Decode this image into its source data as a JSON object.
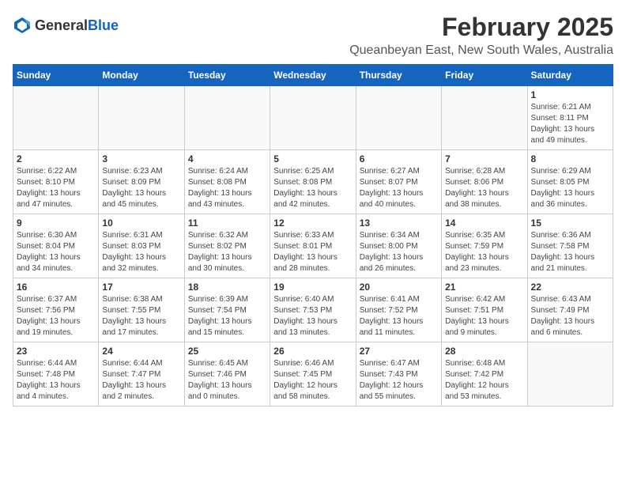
{
  "header": {
    "logo_general": "General",
    "logo_blue": "Blue",
    "month": "February 2025",
    "location": "Queanbeyan East, New South Wales, Australia"
  },
  "days_of_week": [
    "Sunday",
    "Monday",
    "Tuesday",
    "Wednesday",
    "Thursday",
    "Friday",
    "Saturday"
  ],
  "weeks": [
    [
      {
        "day": "",
        "info": ""
      },
      {
        "day": "",
        "info": ""
      },
      {
        "day": "",
        "info": ""
      },
      {
        "day": "",
        "info": ""
      },
      {
        "day": "",
        "info": ""
      },
      {
        "day": "",
        "info": ""
      },
      {
        "day": "1",
        "info": "Sunrise: 6:21 AM\nSunset: 8:11 PM\nDaylight: 13 hours\nand 49 minutes."
      }
    ],
    [
      {
        "day": "2",
        "info": "Sunrise: 6:22 AM\nSunset: 8:10 PM\nDaylight: 13 hours\nand 47 minutes."
      },
      {
        "day": "3",
        "info": "Sunrise: 6:23 AM\nSunset: 8:09 PM\nDaylight: 13 hours\nand 45 minutes."
      },
      {
        "day": "4",
        "info": "Sunrise: 6:24 AM\nSunset: 8:08 PM\nDaylight: 13 hours\nand 43 minutes."
      },
      {
        "day": "5",
        "info": "Sunrise: 6:25 AM\nSunset: 8:08 PM\nDaylight: 13 hours\nand 42 minutes."
      },
      {
        "day": "6",
        "info": "Sunrise: 6:27 AM\nSunset: 8:07 PM\nDaylight: 13 hours\nand 40 minutes."
      },
      {
        "day": "7",
        "info": "Sunrise: 6:28 AM\nSunset: 8:06 PM\nDaylight: 13 hours\nand 38 minutes."
      },
      {
        "day": "8",
        "info": "Sunrise: 6:29 AM\nSunset: 8:05 PM\nDaylight: 13 hours\nand 36 minutes."
      }
    ],
    [
      {
        "day": "9",
        "info": "Sunrise: 6:30 AM\nSunset: 8:04 PM\nDaylight: 13 hours\nand 34 minutes."
      },
      {
        "day": "10",
        "info": "Sunrise: 6:31 AM\nSunset: 8:03 PM\nDaylight: 13 hours\nand 32 minutes."
      },
      {
        "day": "11",
        "info": "Sunrise: 6:32 AM\nSunset: 8:02 PM\nDaylight: 13 hours\nand 30 minutes."
      },
      {
        "day": "12",
        "info": "Sunrise: 6:33 AM\nSunset: 8:01 PM\nDaylight: 13 hours\nand 28 minutes."
      },
      {
        "day": "13",
        "info": "Sunrise: 6:34 AM\nSunset: 8:00 PM\nDaylight: 13 hours\nand 26 minutes."
      },
      {
        "day": "14",
        "info": "Sunrise: 6:35 AM\nSunset: 7:59 PM\nDaylight: 13 hours\nand 23 minutes."
      },
      {
        "day": "15",
        "info": "Sunrise: 6:36 AM\nSunset: 7:58 PM\nDaylight: 13 hours\nand 21 minutes."
      }
    ],
    [
      {
        "day": "16",
        "info": "Sunrise: 6:37 AM\nSunset: 7:56 PM\nDaylight: 13 hours\nand 19 minutes."
      },
      {
        "day": "17",
        "info": "Sunrise: 6:38 AM\nSunset: 7:55 PM\nDaylight: 13 hours\nand 17 minutes."
      },
      {
        "day": "18",
        "info": "Sunrise: 6:39 AM\nSunset: 7:54 PM\nDaylight: 13 hours\nand 15 minutes."
      },
      {
        "day": "19",
        "info": "Sunrise: 6:40 AM\nSunset: 7:53 PM\nDaylight: 13 hours\nand 13 minutes."
      },
      {
        "day": "20",
        "info": "Sunrise: 6:41 AM\nSunset: 7:52 PM\nDaylight: 13 hours\nand 11 minutes."
      },
      {
        "day": "21",
        "info": "Sunrise: 6:42 AM\nSunset: 7:51 PM\nDaylight: 13 hours\nand 9 minutes."
      },
      {
        "day": "22",
        "info": "Sunrise: 6:43 AM\nSunset: 7:49 PM\nDaylight: 13 hours\nand 6 minutes."
      }
    ],
    [
      {
        "day": "23",
        "info": "Sunrise: 6:44 AM\nSunset: 7:48 PM\nDaylight: 13 hours\nand 4 minutes."
      },
      {
        "day": "24",
        "info": "Sunrise: 6:44 AM\nSunset: 7:47 PM\nDaylight: 13 hours\nand 2 minutes."
      },
      {
        "day": "25",
        "info": "Sunrise: 6:45 AM\nSunset: 7:46 PM\nDaylight: 13 hours\nand 0 minutes."
      },
      {
        "day": "26",
        "info": "Sunrise: 6:46 AM\nSunset: 7:45 PM\nDaylight: 12 hours\nand 58 minutes."
      },
      {
        "day": "27",
        "info": "Sunrise: 6:47 AM\nSunset: 7:43 PM\nDaylight: 12 hours\nand 55 minutes."
      },
      {
        "day": "28",
        "info": "Sunrise: 6:48 AM\nSunset: 7:42 PM\nDaylight: 12 hours\nand 53 minutes."
      },
      {
        "day": "",
        "info": ""
      }
    ]
  ]
}
